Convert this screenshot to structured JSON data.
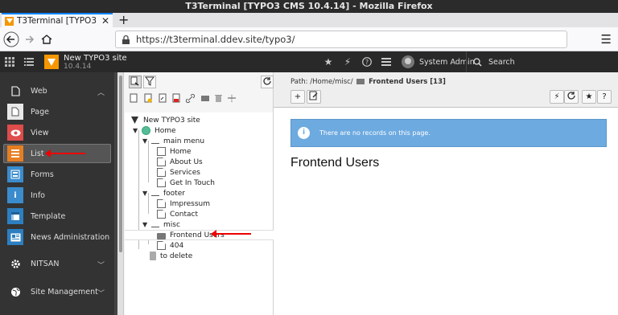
{
  "browser": {
    "window_title": "T3Terminal [TYPO3 CMS 10.4.14] - Mozilla Firefox",
    "tab_title": "T3Terminal [TYPO3 CMS",
    "url": "https://t3terminal.ddev.site/typo3/"
  },
  "topbar": {
    "site_name": "New TYPO3 site",
    "site_version": "10.4.14",
    "user_name": "System Admin",
    "search_label": "Search"
  },
  "modules": {
    "groups": [
      {
        "label": "Web"
      },
      {
        "label": "NITSAN"
      },
      {
        "label": "Site Management"
      }
    ],
    "items": [
      {
        "label": "Page",
        "color": "#e8e8e8"
      },
      {
        "label": "View",
        "color": "#de4c4c"
      },
      {
        "label": "List",
        "color": "#e67e22"
      },
      {
        "label": "Forms",
        "color": "#3b8ccd"
      },
      {
        "label": "Info",
        "color": "#3b8ccd"
      },
      {
        "label": "Template",
        "color": "#2d7fc0"
      },
      {
        "label": "News Administration",
        "color": "#2d7fc0"
      }
    ]
  },
  "tree": {
    "root": "New TYPO3 site",
    "home": "Home",
    "main_menu": "main menu",
    "home_page": "Home",
    "about": "About Us",
    "services": "Services",
    "contact_us": "Get In Touch",
    "footer": "footer",
    "impressum": "Impressum",
    "contact": "Contact",
    "misc": "misc",
    "frontend_users": "Frontend Users",
    "p404": "404",
    "to_delete": "to delete"
  },
  "content": {
    "path_prefix": "Path: /Home/misc/",
    "path_current": "Frontend Users [13]",
    "info_message": "There are no records on this page.",
    "page_title": "Frontend Users"
  }
}
